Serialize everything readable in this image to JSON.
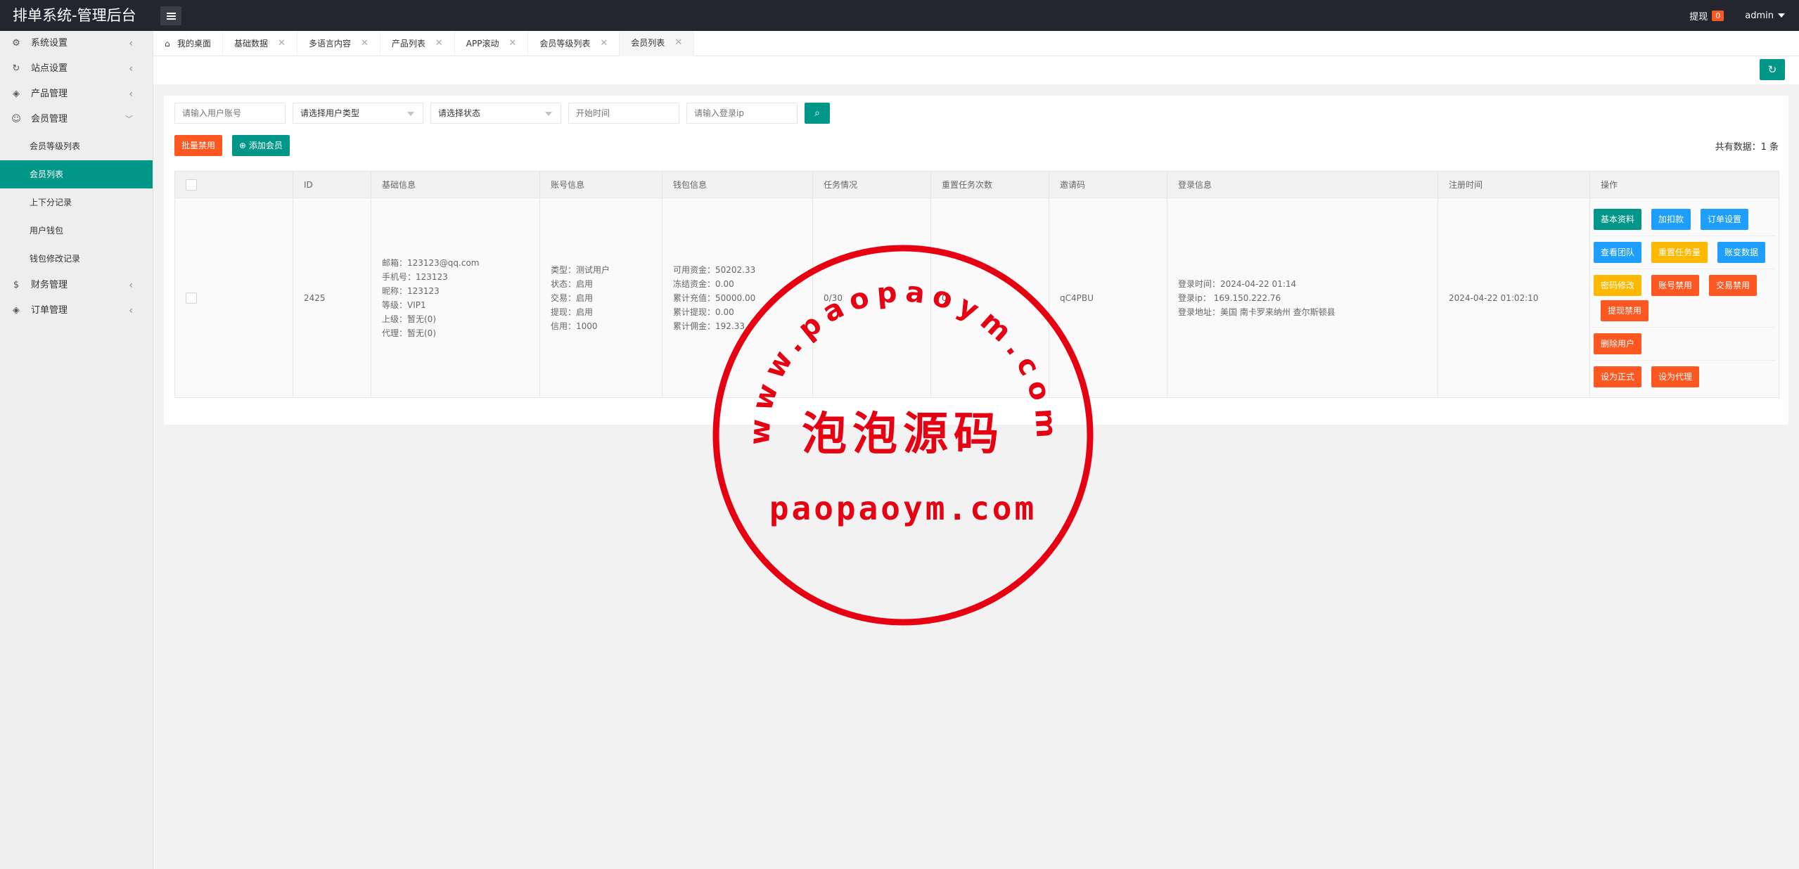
{
  "header": {
    "brand": "排单系统-管理后台",
    "withdraw_label": "提现",
    "withdraw_count": "0",
    "user": "admin"
  },
  "sidebar": {
    "items": [
      {
        "label": "系统设置",
        "icon": "gear-icon"
      },
      {
        "label": "站点设置",
        "icon": "refresh-icon"
      },
      {
        "label": "产品管理",
        "icon": "box-icon"
      },
      {
        "label": "会员管理",
        "icon": "user-icon"
      }
    ],
    "member_sub": [
      {
        "label": "会员等级列表"
      },
      {
        "label": "会员列表"
      },
      {
        "label": "上下分记录"
      },
      {
        "label": "用户钱包"
      },
      {
        "label": "钱包修改记录"
      }
    ],
    "bottom_items": [
      {
        "label": "财务管理",
        "icon": "dollar-icon"
      },
      {
        "label": "订单管理",
        "icon": "box-icon"
      }
    ]
  },
  "tabs": [
    {
      "label": "我的桌面"
    },
    {
      "label": "基础数据"
    },
    {
      "label": "多语言内容"
    },
    {
      "label": "产品列表"
    },
    {
      "label": "APP滚动"
    },
    {
      "label": "会员等级列表"
    },
    {
      "label": "会员列表"
    }
  ],
  "filters": {
    "account_placeholder": "请输入用户账号",
    "user_type": "请选择用户类型",
    "status": "请选择状态",
    "start_time_placeholder": "开始时间",
    "login_ip_placeholder": "请输入登录ip"
  },
  "toolbar": {
    "batch_disable": "批量禁用",
    "add_member": "添加会员",
    "total": "共有数据：1 条"
  },
  "table": {
    "headers": [
      "ID",
      "基础信息",
      "账号信息",
      "钱包信息",
      "任务情况",
      "重置任务次数",
      "邀请码",
      "登录信息",
      "注册时间",
      "操作"
    ],
    "row": {
      "id": "2425",
      "basic": [
        "邮箱：123123@qq.com",
        "手机号：123123",
        "昵称：123123",
        "等级：VIP1",
        "上级：暂无(0)",
        "代理：暂无(0)"
      ],
      "account": [
        "类型：测试用户",
        "状态：启用",
        "交易：启用",
        "提现：启用",
        "信用：1000"
      ],
      "wallet": [
        "可用资金：50202.33",
        "冻结资金：0.00",
        "累计充值：50000.00",
        "累计提现：0.00",
        "累计佣金：192.33"
      ],
      "task": "0/30",
      "reset": "0",
      "invite": "qC4PBU",
      "login": [
        "登录时间：2024-04-22 01:14",
        "登录ip： 169.150.222.76",
        "登录地址：美国 南卡罗来纳州 查尔斯顿县"
      ],
      "register": "2024-04-22 01:02:10"
    },
    "ops": [
      [
        "基本资料",
        "加扣款",
        "订单设置"
      ],
      [
        "查看团队",
        "重置任务量",
        "账变数据"
      ],
      [
        "密码修改",
        "账号禁用",
        "交易禁用",
        "提现禁用"
      ],
      [
        "删除用户"
      ],
      [
        "设为正式",
        "设为代理"
      ]
    ]
  },
  "watermark": {
    "arc_text": "www.paopaoym.com",
    "center_text": "泡泡源码",
    "bottom_text": "paopaoym.com",
    "color": "#e60012"
  }
}
